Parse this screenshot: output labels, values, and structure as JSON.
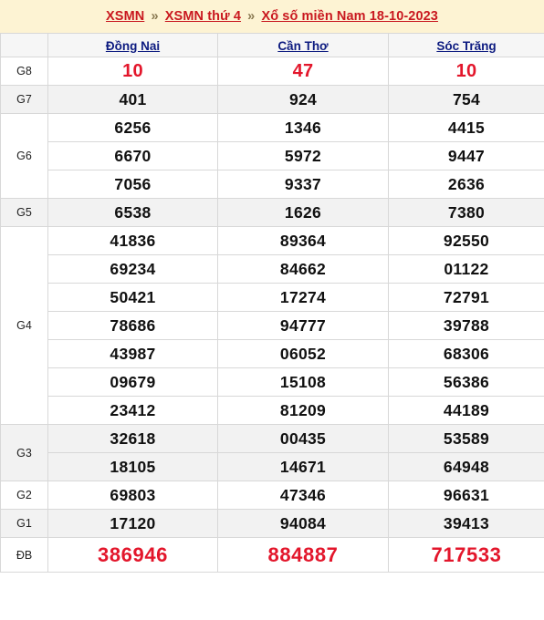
{
  "breadcrumb": {
    "separator": "»",
    "items": [
      {
        "label": "XSMN"
      },
      {
        "label": "XSMN thứ 4"
      },
      {
        "label": "Xổ số miền Nam 18-10-2023"
      }
    ]
  },
  "colors": {
    "banner_bg": "#fdf3d3",
    "crumb_link": "#c9181f",
    "province_link": "#0d1b80",
    "highlight_red": "#e3162b",
    "row_stripe": "#f2f2f2",
    "border": "#d8d8d8"
  },
  "table": {
    "corner_label": "",
    "provinces": [
      {
        "name": "Đồng Nai"
      },
      {
        "name": "Cần Thơ"
      },
      {
        "name": "Sóc Trăng"
      }
    ],
    "prizes": [
      {
        "label": "G8",
        "style": "red",
        "stripe": "white",
        "rows": [
          [
            "10",
            "47",
            "10"
          ]
        ]
      },
      {
        "label": "G7",
        "style": "normal",
        "stripe": "grey",
        "rows": [
          [
            "401",
            "924",
            "754"
          ]
        ]
      },
      {
        "label": "G6",
        "style": "normal",
        "stripe": "white",
        "rows": [
          [
            "6256",
            "1346",
            "4415"
          ],
          [
            "6670",
            "5972",
            "9447"
          ],
          [
            "7056",
            "9337",
            "2636"
          ]
        ]
      },
      {
        "label": "G5",
        "style": "normal",
        "stripe": "grey",
        "rows": [
          [
            "6538",
            "1626",
            "7380"
          ]
        ]
      },
      {
        "label": "G4",
        "style": "normal",
        "stripe": "white",
        "rows": [
          [
            "41836",
            "89364",
            "92550"
          ],
          [
            "69234",
            "84662",
            "01122"
          ],
          [
            "50421",
            "17274",
            "72791"
          ],
          [
            "78686",
            "94777",
            "39788"
          ],
          [
            "43987",
            "06052",
            "68306"
          ],
          [
            "09679",
            "15108",
            "56386"
          ],
          [
            "23412",
            "81209",
            "44189"
          ]
        ]
      },
      {
        "label": "G3",
        "style": "normal",
        "stripe": "grey",
        "rows": [
          [
            "32618",
            "00435",
            "53589"
          ],
          [
            "18105",
            "14671",
            "64948"
          ]
        ]
      },
      {
        "label": "G2",
        "style": "normal",
        "stripe": "white",
        "rows": [
          [
            "69803",
            "47346",
            "96631"
          ]
        ]
      },
      {
        "label": "G1",
        "style": "normal",
        "stripe": "grey",
        "rows": [
          [
            "17120",
            "94084",
            "39413"
          ]
        ]
      },
      {
        "label": "ĐB",
        "style": "db",
        "stripe": "white",
        "rows": [
          [
            "386946",
            "884887",
            "717533"
          ]
        ]
      }
    ]
  }
}
